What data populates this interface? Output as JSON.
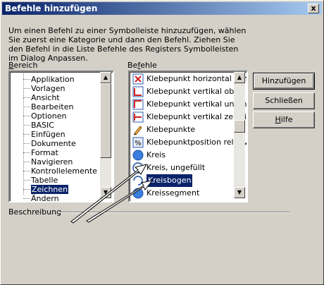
{
  "window": {
    "title": "Befehle hinzufügen",
    "close_glyph": "x"
  },
  "description": "Um einen Befehl zu einer Symbolleiste hinzuzufügen, wählen Sie zuerst eine Kategorie und dann den Befehl. Ziehen Sie den Befehl in die Liste Befehle des Registers Symbolleisten im Dialog Anpassen.",
  "area": {
    "label_u": "B",
    "label_rest": "ereich",
    "items": [
      "Applikation",
      "Vorlagen",
      "Ansicht",
      "Bearbeiten",
      "Optionen",
      "BASIC",
      "Einfügen",
      "Dokumente",
      "Format",
      "Navigieren",
      "Kontrollelemente",
      "Tabelle",
      "Zeichnen",
      "Ändern"
    ],
    "selected_index": 12
  },
  "commands": {
    "label_pre": "Be",
    "label_u": "f",
    "label_rest": "ehle",
    "items": [
      {
        "label": "Klebepunkt horizontal zen",
        "icon": "glue-horizontal-icon"
      },
      {
        "label": "Klebepunkt vertikal oben",
        "icon": "glue-vertical-top-icon"
      },
      {
        "label": "Klebepunkt vertikal unten",
        "icon": "glue-vertical-bottom-icon"
      },
      {
        "label": "Klebepunkt vertikal zentri",
        "icon": "glue-vertical-center-icon"
      },
      {
        "label": "Klebepunkte",
        "icon": "pencil-icon"
      },
      {
        "label": "Klebepunktposition relativ",
        "icon": "percent-icon"
      },
      {
        "label": "Kreis",
        "icon": "circle-filled-icon"
      },
      {
        "label": "Kreis, ungefüllt",
        "icon": "circle-empty-icon"
      },
      {
        "label": "Kreisbogen",
        "icon": "arc-icon"
      },
      {
        "label": "Kreissegment",
        "icon": "circle-segment-icon"
      }
    ],
    "selected_index": 8
  },
  "buttons": {
    "add": "Hinzufügen",
    "close": "Schließen",
    "help_u": "H",
    "help_rest": "ilfe"
  },
  "footer": {
    "label": "Beschreibung"
  },
  "colors": {
    "title_start": "#0a246a",
    "title_end": "#a6caf0",
    "selection": "#0a246a",
    "face": "#d4d0c8"
  }
}
